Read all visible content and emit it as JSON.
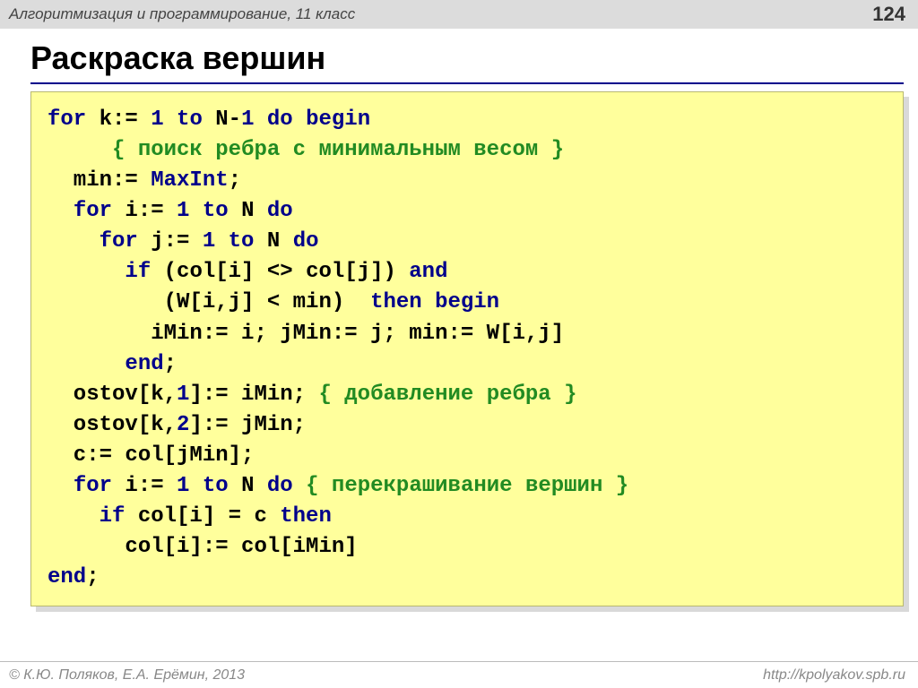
{
  "header": {
    "course": "Алгоритмизация и программирование, 11 класс",
    "page": "124"
  },
  "title": "Раскраска вершин",
  "code": {
    "tokens": [
      [
        [
          "kw",
          "for"
        ],
        [
          "",
          " k:= "
        ],
        [
          "num",
          "1"
        ],
        [
          "",
          " "
        ],
        [
          "kw",
          "to"
        ],
        [
          "",
          " N-"
        ],
        [
          "num",
          "1"
        ],
        [
          "",
          " "
        ],
        [
          "kw",
          "do begin"
        ]
      ],
      [
        [
          "",
          "     "
        ],
        [
          "cmt",
          "{ поиск ребра с минимальным весом }"
        ]
      ],
      [
        [
          "",
          "  min:= "
        ],
        [
          "ident",
          "MaxInt"
        ],
        [
          "",
          ";"
        ]
      ],
      [
        [
          "",
          "  "
        ],
        [
          "kw",
          "for"
        ],
        [
          "",
          " i:= "
        ],
        [
          "num",
          "1"
        ],
        [
          "",
          " "
        ],
        [
          "kw",
          "to"
        ],
        [
          "",
          " N "
        ],
        [
          "kw",
          "do"
        ]
      ],
      [
        [
          "",
          "    "
        ],
        [
          "kw",
          "for"
        ],
        [
          "",
          " j:= "
        ],
        [
          "num",
          "1"
        ],
        [
          "",
          " "
        ],
        [
          "kw",
          "to"
        ],
        [
          "",
          " N "
        ],
        [
          "kw",
          "do"
        ]
      ],
      [
        [
          "",
          "      "
        ],
        [
          "kw",
          "if"
        ],
        [
          "",
          " (col[i] <> col[j]) "
        ],
        [
          "kw",
          "and"
        ]
      ],
      [
        [
          "",
          "         (W[i,j] < min)  "
        ],
        [
          "kw",
          "then begin"
        ]
      ],
      [
        [
          "",
          "        iMin:= i; jMin:= j; min:= W[i,j]"
        ]
      ],
      [
        [
          "",
          "      "
        ],
        [
          "kw",
          "end"
        ],
        [
          "",
          ";"
        ]
      ],
      [
        [
          "",
          "  ostov[k,"
        ],
        [
          "num",
          "1"
        ],
        [
          "",
          "]:= iMin; "
        ],
        [
          "cmt",
          "{ добавление ребра }"
        ]
      ],
      [
        [
          "",
          "  ostov[k,"
        ],
        [
          "num",
          "2"
        ],
        [
          "",
          "]:= jMin;"
        ]
      ],
      [
        [
          "",
          "  c:= col[jMin];"
        ]
      ],
      [
        [
          "",
          "  "
        ],
        [
          "kw",
          "for"
        ],
        [
          "",
          " i:= "
        ],
        [
          "num",
          "1"
        ],
        [
          "",
          " "
        ],
        [
          "kw",
          "to"
        ],
        [
          "",
          " N "
        ],
        [
          "kw",
          "do"
        ],
        [
          "",
          " "
        ],
        [
          "cmt",
          "{ перекрашивание вершин }"
        ]
      ],
      [
        [
          "",
          "    "
        ],
        [
          "kw",
          "if"
        ],
        [
          "",
          " col[i] = c "
        ],
        [
          "kw",
          "then"
        ]
      ],
      [
        [
          "",
          "      col[i]:= col[iMin]"
        ]
      ],
      [
        [
          "kw",
          "end"
        ],
        [
          "",
          ";"
        ]
      ]
    ]
  },
  "footer": {
    "copyright": "© К.Ю. Поляков, Е.А. Ерёмин, 2013",
    "url": "http://kpolyakov.spb.ru"
  }
}
